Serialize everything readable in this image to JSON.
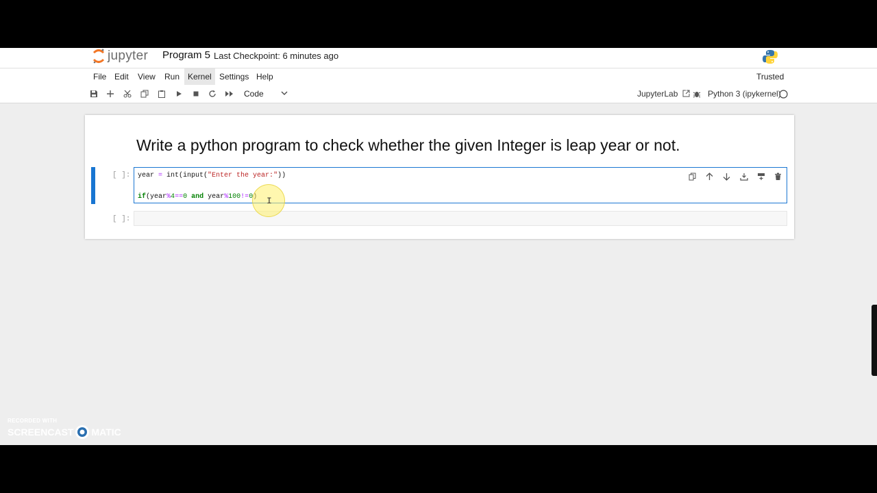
{
  "header": {
    "logo_text": "jupyter",
    "notebook_title": "Program 5",
    "checkpoint": "Last Checkpoint: 6 minutes ago"
  },
  "menu": {
    "items": [
      "File",
      "Edit",
      "View",
      "Run",
      "Kernel",
      "Settings",
      "Help"
    ],
    "active": "Kernel",
    "trusted": "Trusted"
  },
  "toolbar": {
    "cell_type": "Code",
    "jupyterlab_link": "JupyterLab",
    "kernel_name": "Python 3 (ipykernel)"
  },
  "notebook": {
    "markdown_heading": "Write a python program to check whether the given Integer is leap year or not.",
    "code_cell": {
      "prompt": "[ ]:",
      "lines": [
        "year = int(input(\"Enter the year:\"))",
        "",
        "if(year%4==0 and year%100!=0)"
      ]
    },
    "empty_cell": {
      "prompt": "[ ]:"
    }
  },
  "watermark": {
    "line1": "RECORDED WITH",
    "line2a": "SCREENCAST",
    "line2b": "MATIC"
  },
  "colors": {
    "accent": "#1976d2",
    "cursor_highlight": "#fff06e"
  }
}
